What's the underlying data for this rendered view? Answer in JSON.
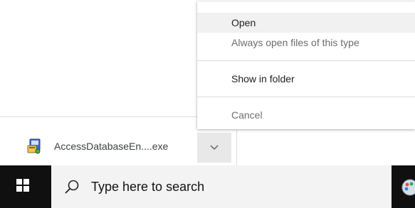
{
  "context_menu": {
    "items": [
      {
        "label": "Open"
      },
      {
        "label": "Always open files of this type"
      },
      {
        "label": "Show in folder"
      },
      {
        "label": "Cancel"
      }
    ]
  },
  "download_shelf": {
    "file_name": "AccessDatabaseEn....exe",
    "file_icon": "installer-icon",
    "toggle_icon": "chevron-down-icon"
  },
  "taskbar": {
    "start_icon": "windows-logo-icon",
    "search_icon": "search-icon",
    "search_placeholder": "Type here to search",
    "app_icon": "paint-app-icon"
  },
  "colors": {
    "taskbar_bg": "#101010",
    "search_bg": "#f3f3f3",
    "menu_highlight": "#f1f1f1",
    "toggle_bg": "#e8e8e8"
  }
}
